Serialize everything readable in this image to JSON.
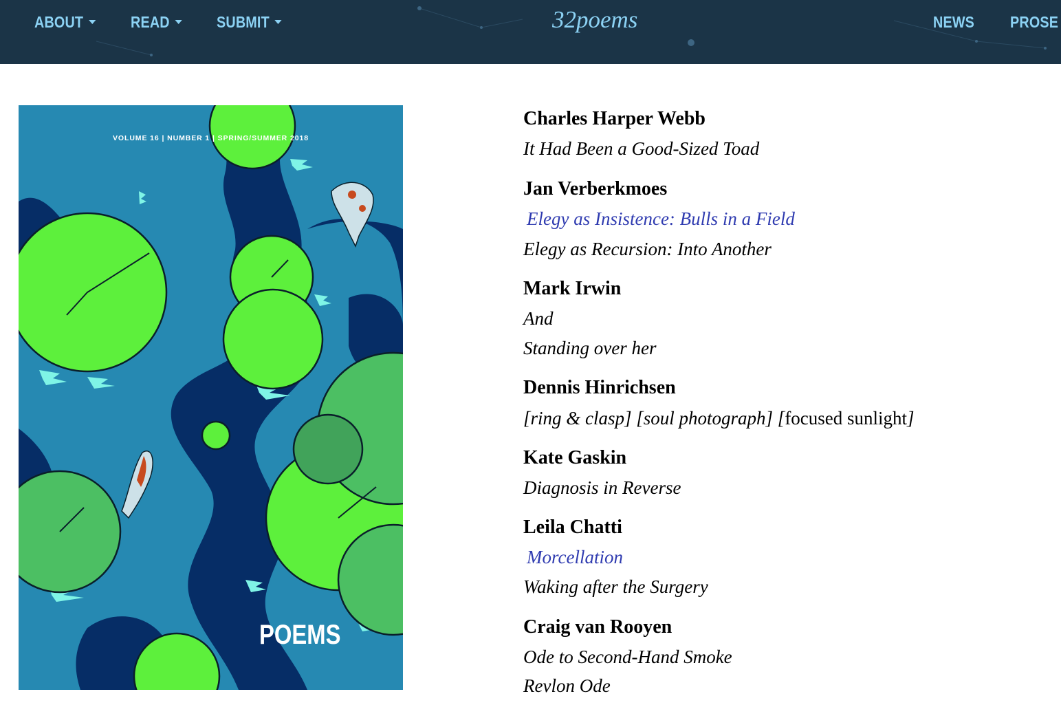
{
  "nav": {
    "left": [
      {
        "label": "ABOUT",
        "icon": "caret-down-icon"
      },
      {
        "label": "READ",
        "icon": "caret-down-icon"
      },
      {
        "label": "SUBMIT",
        "icon": "caret-down-icon"
      }
    ],
    "logo": "32poems",
    "right": [
      {
        "label": "NEWS"
      },
      {
        "label": "PROSE"
      }
    ]
  },
  "cover": {
    "volume_line": "VOLUME 16 | NUMBER 1 | SPRING/SUMMER 2018",
    "title": "POEMS"
  },
  "toc": [
    {
      "author": "Charles Harper Webb",
      "poems": [
        {
          "title": "It Had Been a Good-Sized Toad",
          "link": false
        }
      ]
    },
    {
      "author": "Jan Verberkmoes",
      "poems": [
        {
          "title": "Elegy as Insistence: Bulls in a Field",
          "link": true
        },
        {
          "title": "Elegy as Recursion: Into Another",
          "link": false
        }
      ]
    },
    {
      "author": "Mark Irwin",
      "poems": [
        {
          "title": "And",
          "link": false
        },
        {
          "title": "Standing over her",
          "link": false
        }
      ]
    },
    {
      "author": "Dennis Hinrichsen",
      "poems": [
        {
          "title": "[ring & clasp] [soul photograph] [",
          "title_roman": "focused sunlight",
          "title_end": "]",
          "link": false
        }
      ]
    },
    {
      "author": "Kate Gaskin",
      "poems": [
        {
          "title": "Diagnosis in Reverse",
          "link": false
        }
      ]
    },
    {
      "author": "Leila Chatti",
      "poems": [
        {
          "title": "Morcellation",
          "link": true
        },
        {
          "title": "Waking after the Surgery",
          "link": false
        }
      ]
    },
    {
      "author": "Craig van Rooyen",
      "poems": [
        {
          "title": "Ode to Second-Hand Smoke",
          "link": false
        },
        {
          "title": "Revlon Ode",
          "link": false
        }
      ]
    }
  ],
  "colors": {
    "header_bg": "#1b3447",
    "nav_text": "#8cd2f4",
    "link": "#2f3bb0",
    "cover_water": "#2689b2",
    "cover_channel": "#062d66",
    "lily_bright": "#5df03c",
    "lily_muted": "#4cbf63"
  }
}
